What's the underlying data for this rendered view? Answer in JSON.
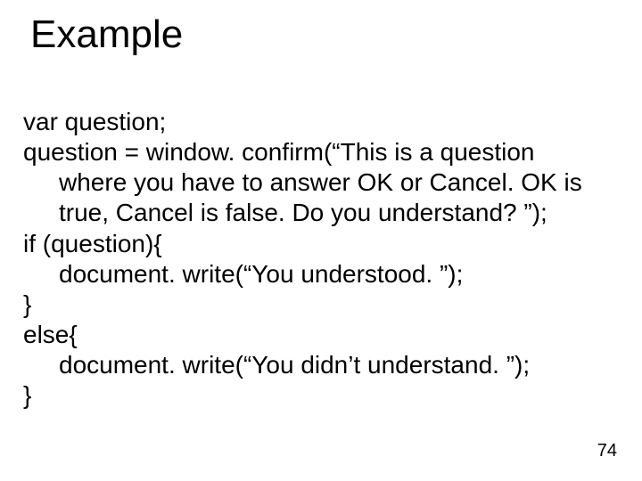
{
  "title": "Example",
  "code": {
    "l1": "var question;",
    "l2": "question = window. confirm(“This is a question",
    "l3": "where you have to answer OK or Cancel. OK is",
    "l4": "true, Cancel is false. Do you understand? ”);",
    "l5": "if (question){",
    "l6": "document. write(“You understood. ”);",
    "l7": "}",
    "l8": "else{",
    "l9": "document. write(“You didn’t understand. ”);",
    "l10": "}"
  },
  "page_number": "74"
}
